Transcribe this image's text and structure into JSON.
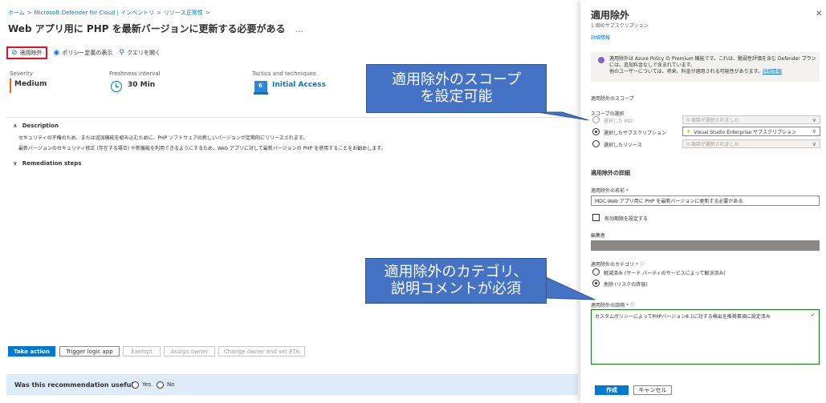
{
  "breadcrumb": [
    "ホーム",
    "Microsoft Defender for Cloud | インベントリ",
    "リソース正常性"
  ],
  "page": {
    "title": "Web アプリ用に PHP を最新バージョンに更新する必要がある",
    "more": "…"
  },
  "toolbar": {
    "exempt": "適用除外",
    "policy": "ポリシー定義の表示",
    "query": "クエリを開く"
  },
  "meta": {
    "severity_label": "Severity",
    "severity_value": "Medium",
    "freshness_label": "Freshness interval",
    "freshness_value": "30 Min",
    "tactics_label": "Tactics and techniques",
    "tactics_value": "Initial Access",
    "tactics_count": "6"
  },
  "description": {
    "heading": "Description",
    "line1": "セキュリティの不備のため、または追加機能を組み込むために、PHP ソフトウェアの新しいバージョンが定期的にリリースされます。",
    "line2": "最新バージョンのセキュリティ修正 (存在する場合) や新機能を利用できるようにするため、Web アプリに対して最新バージョンの PHP を使用することをお勧めします。"
  },
  "remediation": {
    "heading": "Remediation steps"
  },
  "actions": {
    "take_action": "Take action",
    "trigger": "Trigger logic app",
    "exempt": "Exempt",
    "assign_owner": "Assign owner",
    "change_owner": "Change owner and set ETA"
  },
  "feedback": {
    "question": "Was this recommendation useful?",
    "yes": "Yes",
    "no": "No"
  },
  "callouts": {
    "scope_line1": "適用除外のスコープ",
    "scope_line2": "を設定可能",
    "category_line1": "適用除外のカテゴリ、",
    "category_line2": "説明コメントが必須"
  },
  "panel": {
    "title": "適用除外",
    "subtitle": "1 個のサブスクリプション",
    "link": "詳細情報",
    "info_line1": "適用除外は Azure Policy の Premium 機能です。これは、脆弱性評価を含む Defender プラン",
    "info_line2": "には、追加料金なしで含まれています。",
    "info_line3": "他のユーザーについては、将来、料金が適用される可能性があります。",
    "info_link": "詳細情報",
    "scope_heading": "適用除外のスコープ",
    "scope_select_label": "スコープの選択",
    "scope_mg": "選択した MG",
    "scope_mg_value": "0 項目が選択されました",
    "scope_sub": "選択したサブスクリプション",
    "scope_sub_value": "Visual Studio Enterprise サブスクリプション",
    "scope_res": "選択したリソース",
    "scope_res_value": "0 項目が選択されました",
    "details_heading": "適用除外の詳細",
    "name_label": "適用除外の名前",
    "name_value": "MDC-Web アプリ用に PHP を最新バージョンに更新する必要がある",
    "expiry_label": "有効期限を設定する",
    "editor_label": "編集者",
    "category_label": "適用除外のカテゴリ",
    "category_mitigated": "軽減済み (サード パーティのサービスによって解決済み)",
    "category_waiver": "免除 (リスクの許容)",
    "desc_label": "適用除外の説明",
    "desc_value": "カスタムポリシーによってPHPバージョン8.1に対する検出を推奨事項に設定済み",
    "create": "作成",
    "cancel": "キャンセル"
  },
  "colors": {
    "accent": "#0078d4",
    "severity_medium": "#f7630c",
    "callout": "#4472c4",
    "highlight_border": "#e81123"
  }
}
